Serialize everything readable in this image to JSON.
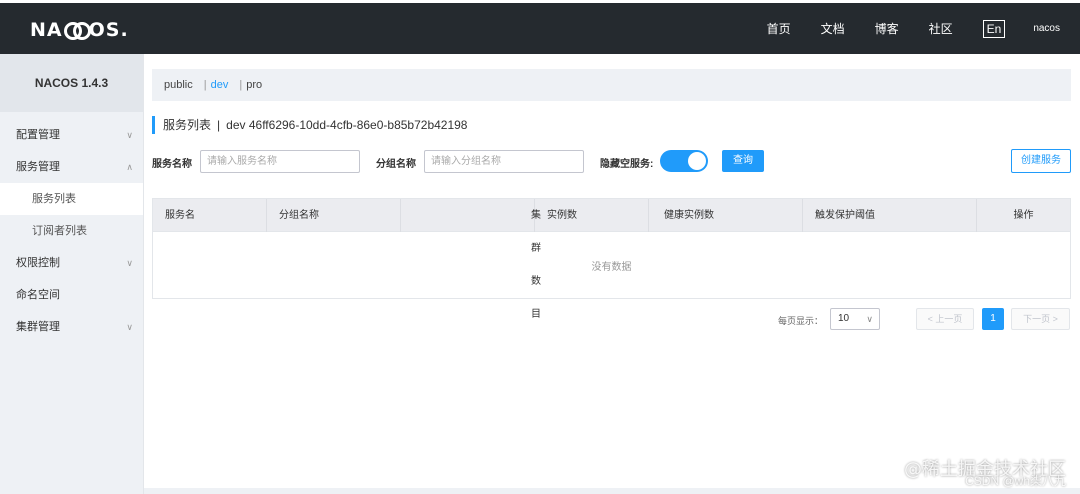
{
  "header": {
    "logo_left": "NA",
    "logo_right": "OS.",
    "nav": [
      "首页",
      "文档",
      "博客",
      "社区"
    ],
    "lang": "En",
    "user": "nacos"
  },
  "sidebar": {
    "version": "NACOS 1.4.3",
    "items": [
      {
        "label": "配置管理",
        "arrow": "∨"
      },
      {
        "label": "服务管理",
        "arrow": "∧"
      },
      {
        "label": "服务列表"
      },
      {
        "label": "订阅者列表"
      },
      {
        "label": "权限控制",
        "arrow": "∨"
      },
      {
        "label": "命名空间"
      },
      {
        "label": "集群管理",
        "arrow": "∨"
      }
    ]
  },
  "namespaces": {
    "items": [
      "public",
      "dev",
      "pro"
    ],
    "active": "dev"
  },
  "page_title": {
    "label": "服务列表",
    "divider": "|",
    "ns_name": "dev",
    "ns_id": "46ff6296-10dd-4cfb-86e0-b85b72b42198"
  },
  "filters": {
    "service_label": "服务名称",
    "service_placeholder": "请输入服务名称",
    "group_label": "分组名称",
    "group_placeholder": "请输入分组名称",
    "hide_empty_label": "隐藏空服务:",
    "hide_empty_on": true,
    "query_button": "查询",
    "create_button": "创建服务"
  },
  "table": {
    "columns": [
      "服务名",
      "分组名称",
      "集群数目",
      "实例数",
      "健康实例数",
      "触发保护阈值",
      "操作"
    ],
    "empty_text": "没有数据"
  },
  "pagination": {
    "per_page_label": "每页显示：",
    "per_page_value": "10",
    "prev": "< 上一页",
    "current": "1",
    "next": "下一页 >"
  },
  "colors": {
    "accent": "#209bfa",
    "header_bg": "#252a2f",
    "sidebar_bg": "#eef1f5"
  },
  "watermark": {
    "line1": "@稀土掘金技术社区",
    "line2": "CSDN @wh柒八九"
  }
}
